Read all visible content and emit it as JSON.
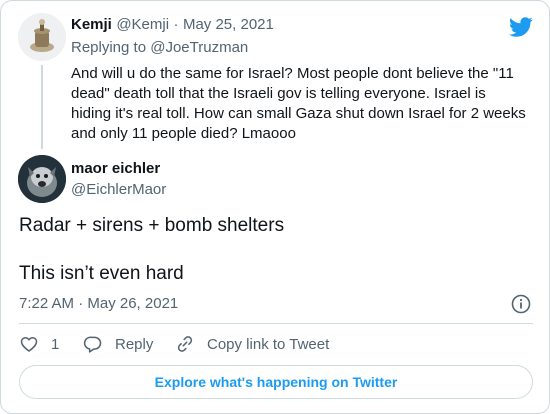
{
  "parent": {
    "name": "Kemji",
    "handle": "@Kemji",
    "separator": "·",
    "date": "May 25, 2021",
    "replying_prefix": "Replying to",
    "replying_handle": "@JoeTruzman",
    "text": "And will u do the same for Israel? Most people dont believe the \"11 dead\" death toll that the Israeli gov is telling everyone. Israel is hiding it's real toll. How can small Gaza shut down Israel for 2 weeks and only 11 people died? Lmaooo"
  },
  "tweet": {
    "name": "maor eichler",
    "handle": "@EichlerMaor",
    "line1": "Radar + sirens + bomb shelters",
    "line2": "This isn’t even hard",
    "timestamp": "7:22 AM · May 26, 2021"
  },
  "actions": {
    "like_count": "1",
    "reply_label": "Reply",
    "copy_label": "Copy link to Tweet"
  },
  "explore_label": "Explore what's happening on Twitter",
  "colors": {
    "brand": "#1d9bf0",
    "text": "#0f1419",
    "muted": "#536471",
    "border": "#cfd9de"
  }
}
